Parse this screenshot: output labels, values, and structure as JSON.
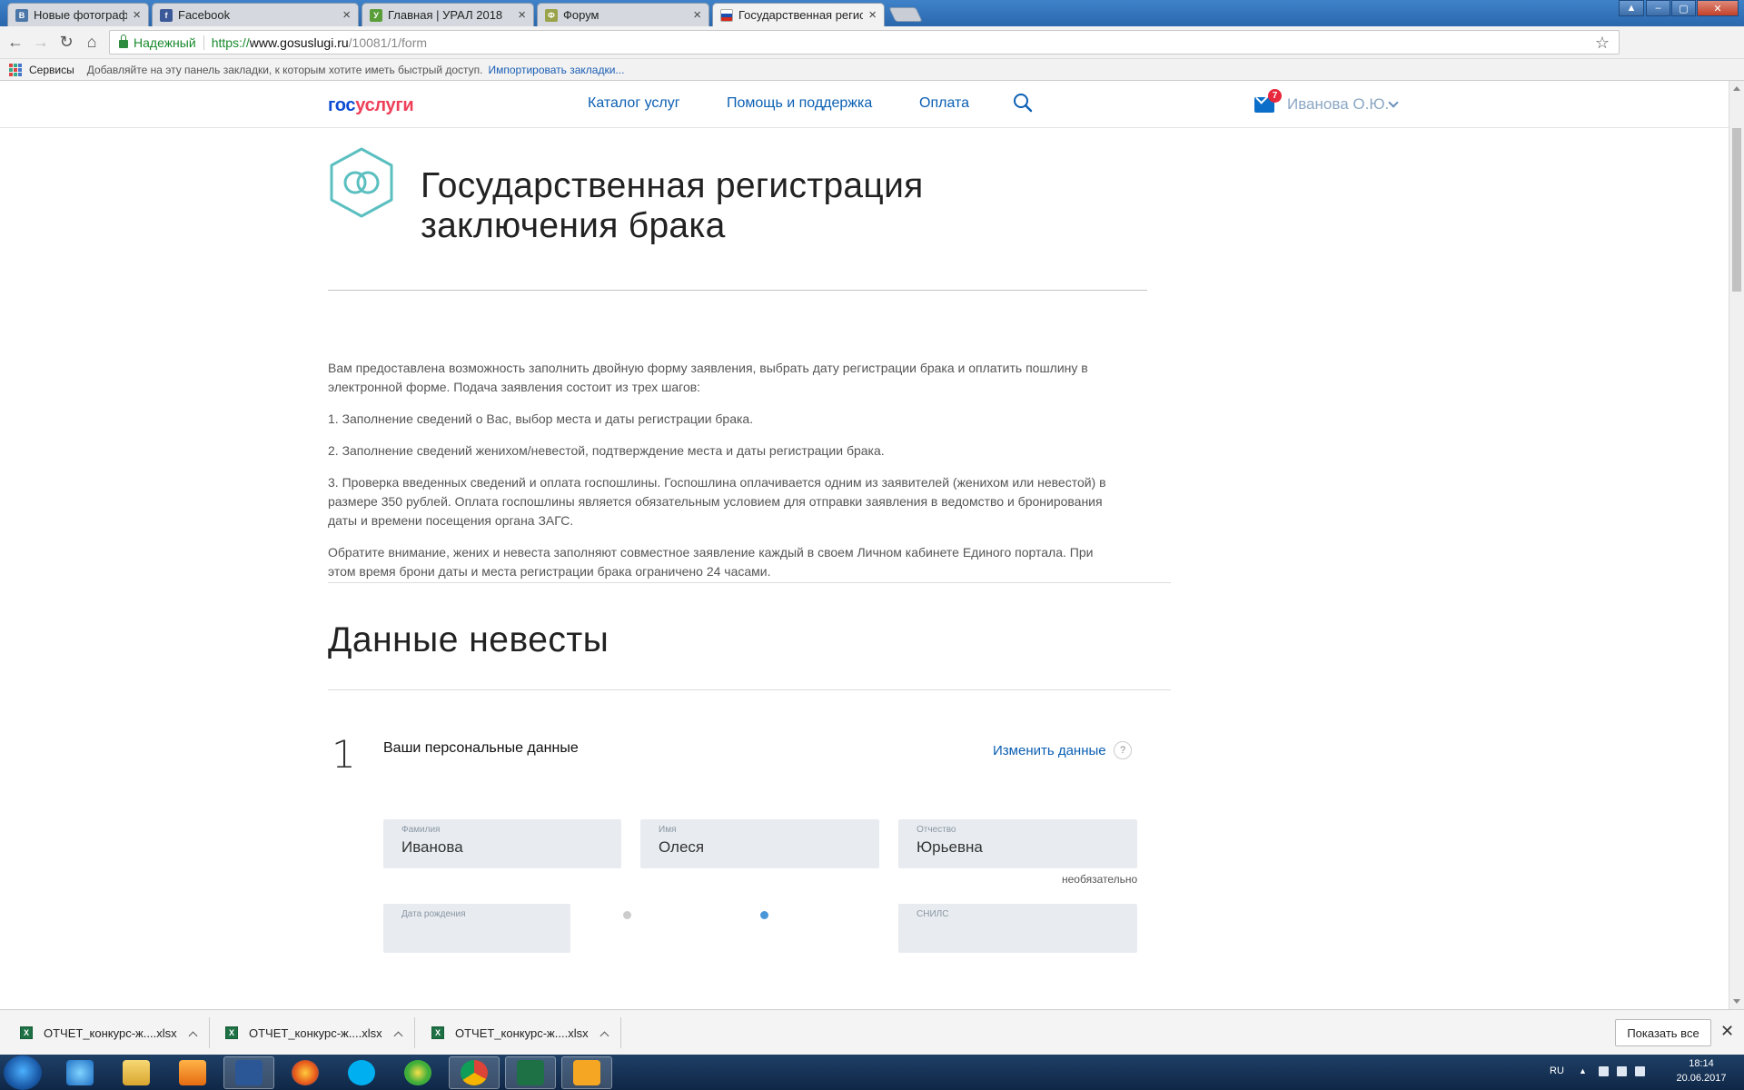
{
  "browser": {
    "tabs": [
      {
        "title": "Новые фотографии",
        "favicon": "vk-icon",
        "color": "#4a76a8"
      },
      {
        "title": "Facebook",
        "favicon": "facebook-icon",
        "color": "#3b5998"
      },
      {
        "title": "Главная | УРАЛ 2018",
        "favicon": "ural-icon",
        "color": "#5a9e3a"
      },
      {
        "title": "Форум",
        "favicon": "forum-icon",
        "color": "#9aa24a"
      },
      {
        "title": "Государственная регист",
        "favicon": "russia-flag-icon",
        "color": "#1a4fb0"
      }
    ],
    "address": {
      "secure_label": "Надежный",
      "scheme": "https://",
      "host": "www.gosuslugi.ru",
      "path": "/10081/1/form"
    },
    "bookmarks": {
      "apps_label": "Сервисы",
      "hint": "Добавляйте на эту панель закладки, к которым хотите иметь быстрый доступ.",
      "import_link": "Импортировать закладки..."
    }
  },
  "site": {
    "logo": {
      "part1": "гос",
      "part2": "услуги"
    },
    "nav": [
      "Каталог услуг",
      "Помощь и поддержка",
      "Оплата"
    ],
    "mail_count": "7",
    "user_name": "Иванова О.Ю.",
    "brand_color": "#0b5fb3"
  },
  "page": {
    "title_line1": "Государственная регистрация",
    "title_line2": "заключения брака",
    "intro": [
      "Вам предоставлена возможность заполнить двойную форму заявления, выбрать дату регистрации брака и оплатить пошлину в электронной форме. Подача заявления состоит из трех шагов:",
      "1. Заполнение сведений о Вас, выбор места и даты регистрации брака.",
      "2. Заполнение сведений женихом/невестой, подтверждение места и даты регистрации брака.",
      "3. Проверка введенных сведений и оплата госпошлины. Госпошлина оплачивается одним из заявителей (женихом или невестой) в размере 350 рублей. Оплата госпошлины является обязательным условием для отправки заявления в ведомство и бронирования даты и времени посещения органа ЗАГС.",
      "Обратите внимание, жених и невеста заполняют совместное заявление каждый в своем Личном кабинете Единого портала. При этом время брони даты и места регистрации брака ограничено 24 часами."
    ],
    "section_title": "Данные невесты",
    "step": {
      "number": "1",
      "title": "Ваши персональные данные",
      "change_link": "Изменить данные",
      "help": "?"
    },
    "fields": {
      "surname": {
        "label": "Фамилия",
        "value": "Иванова"
      },
      "name": {
        "label": "Имя",
        "value": "Олеся"
      },
      "patronymic": {
        "label": "Отчество",
        "value": "Юрьевна"
      },
      "optional_note": "необязательно",
      "birthdate": {
        "label": "Дата рождения"
      },
      "snils": {
        "label": "СНИЛС"
      }
    }
  },
  "downloads": {
    "items": [
      "ОТЧЕТ_конкурс-ж....xlsx",
      "ОТЧЕТ_конкурс-ж....xlsx",
      "ОТЧЕТ_конкурс-ж....xlsx"
    ],
    "show_all": "Показать все"
  },
  "taskbar": {
    "lang": "RU",
    "time": "18:14",
    "date": "20.06.2017"
  }
}
